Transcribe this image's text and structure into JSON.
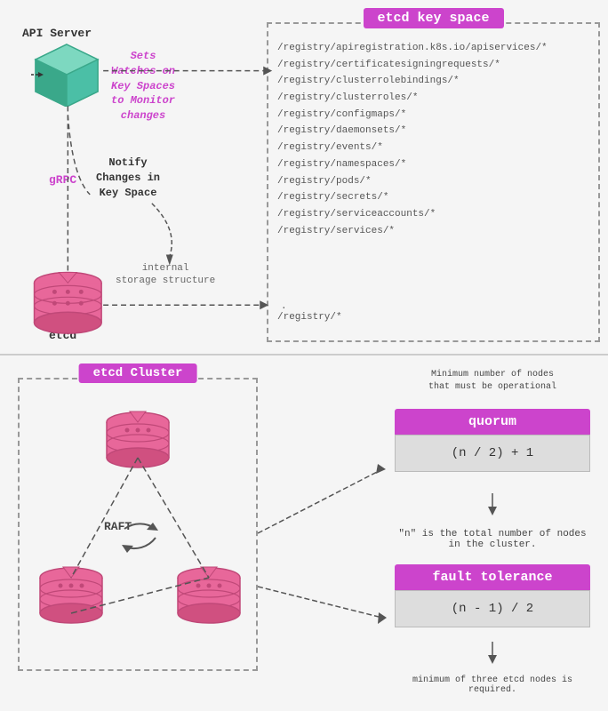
{
  "top": {
    "api_server_label": "API Server",
    "grpc_label": "gRPC",
    "watches_annotation": "Sets\nWatches on\nKey Spaces\nto Monitor\nchanges",
    "notify_label": "Notify\nChanges in\nKey Space",
    "internal_label": "internal\nstorage structure",
    "etcd_label": "etcd",
    "keyspace_title": "etcd key space",
    "keyspace_paths": [
      "/registry/apiregistration.k8s.io/apiservices/*",
      "/registry/certificatesigningrequests/*",
      "/registry/clusterrolebindings/*",
      "/registry/clusterroles/*",
      "/registry/configmaps/*",
      "/registry/daemonsets/*",
      "/registry/events/*",
      "/registry/namespaces/*",
      "/registry/pods/*",
      "/registry/secrets/*",
      "/registry/serviceaccounts/*",
      "/registry/services/*"
    ],
    "keyspace_bottom_path": "/registry/*"
  },
  "bottom": {
    "cluster_title": "etcd Cluster",
    "raft_label": "RAFT",
    "quorum_title": "quorum",
    "quorum_formula": "(n / 2) + 1",
    "fault_title": "fault tolerance",
    "fault_formula": "(n - 1) / 2",
    "min_nodes_label": "Minimum number of nodes\nthat must be operational",
    "n_is_label": "\"n\" is the total number of nodes in the cluster.",
    "min_three_label": "minimum of three etcd nodes is required."
  },
  "colors": {
    "purple": "#cc44cc",
    "dashed_border": "#999",
    "db_color": "#e8679a",
    "cube_color": "#5bc8b0"
  }
}
